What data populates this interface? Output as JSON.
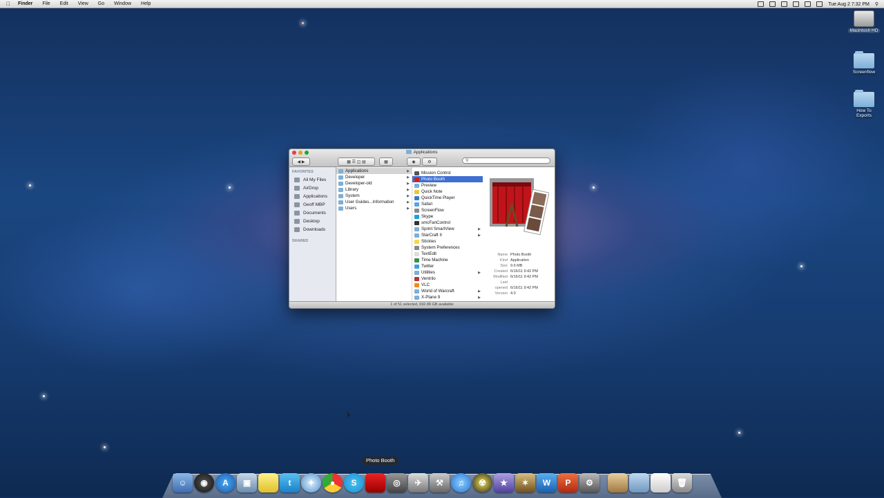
{
  "menubar": {
    "app": "Finder",
    "items": [
      "File",
      "Edit",
      "View",
      "Go",
      "Window",
      "Help"
    ],
    "clock": "Tue Aug 2  7:32 PM"
  },
  "desktop_icons": [
    {
      "label": "Macintosh HD",
      "icon": "hard-drive-icon"
    },
    {
      "label": "Screenflow",
      "icon": "folder-icon"
    },
    {
      "label": "How To Exports",
      "icon": "folder-icon"
    }
  ],
  "window": {
    "title": "Applications",
    "search_placeholder": "",
    "sidebar": {
      "favorites_heading": "FAVORITES",
      "items": [
        "All My Files",
        "AirDrop",
        "Applications",
        "Geoff MBP",
        "Documents",
        "Desktop",
        "Downloads"
      ],
      "shared_heading": "SHARED"
    },
    "col1": [
      "Applications",
      "Developer",
      "Developer-old",
      "Library",
      "System",
      "User Guides...Information",
      "Users"
    ],
    "col2": [
      "Mission Control",
      "Photo Booth",
      "Preview",
      "Quick Note",
      "QuickTime Player",
      "Safari",
      "ScreenFlow",
      "Skype",
      "smcFanControl",
      "Sprint SmartView",
      "StarCraft II",
      "Stickies",
      "System Preferences",
      "TextEdit",
      "Time Machine",
      "Twitter",
      "Utilities",
      "Ventrilo",
      "VLC",
      "World of Warcraft",
      "X-Plane 9"
    ],
    "preview": {
      "name": "Photo Booth",
      "kind": "Application",
      "size": "9.6 MB",
      "created": "6/16/11 9:42 PM",
      "modified": "6/16/11 9:42 PM",
      "last_opened": "6/16/11 9:42 PM",
      "version": "4.0",
      "labels": {
        "name": "Name",
        "kind": "Kind",
        "size": "Size",
        "created": "Created",
        "modified": "Modified",
        "last_opened": "Last opened",
        "version": "Version"
      }
    },
    "status": "1 of 51 selected, 692.88 GB available"
  },
  "dock": {
    "tooltip": "Photo Booth",
    "items": [
      "finder-icon",
      "dashboard-icon",
      "app-store-icon",
      "preview-icon",
      "stickies-icon",
      "twitter-icon",
      "safari-icon",
      "chrome-icon",
      "skype-icon",
      "photo-booth-icon",
      "screenflow-icon",
      "x-plane-icon",
      "utilities-icon",
      "itunes-icon",
      "radioactive-icon",
      "imovie-icon",
      "starcraft-icon",
      "word-icon",
      "powerpoint-icon",
      "system-preferences-icon",
      "documents-stack-icon",
      "applications-stack-icon",
      "file-icon",
      "trash-icon"
    ]
  }
}
